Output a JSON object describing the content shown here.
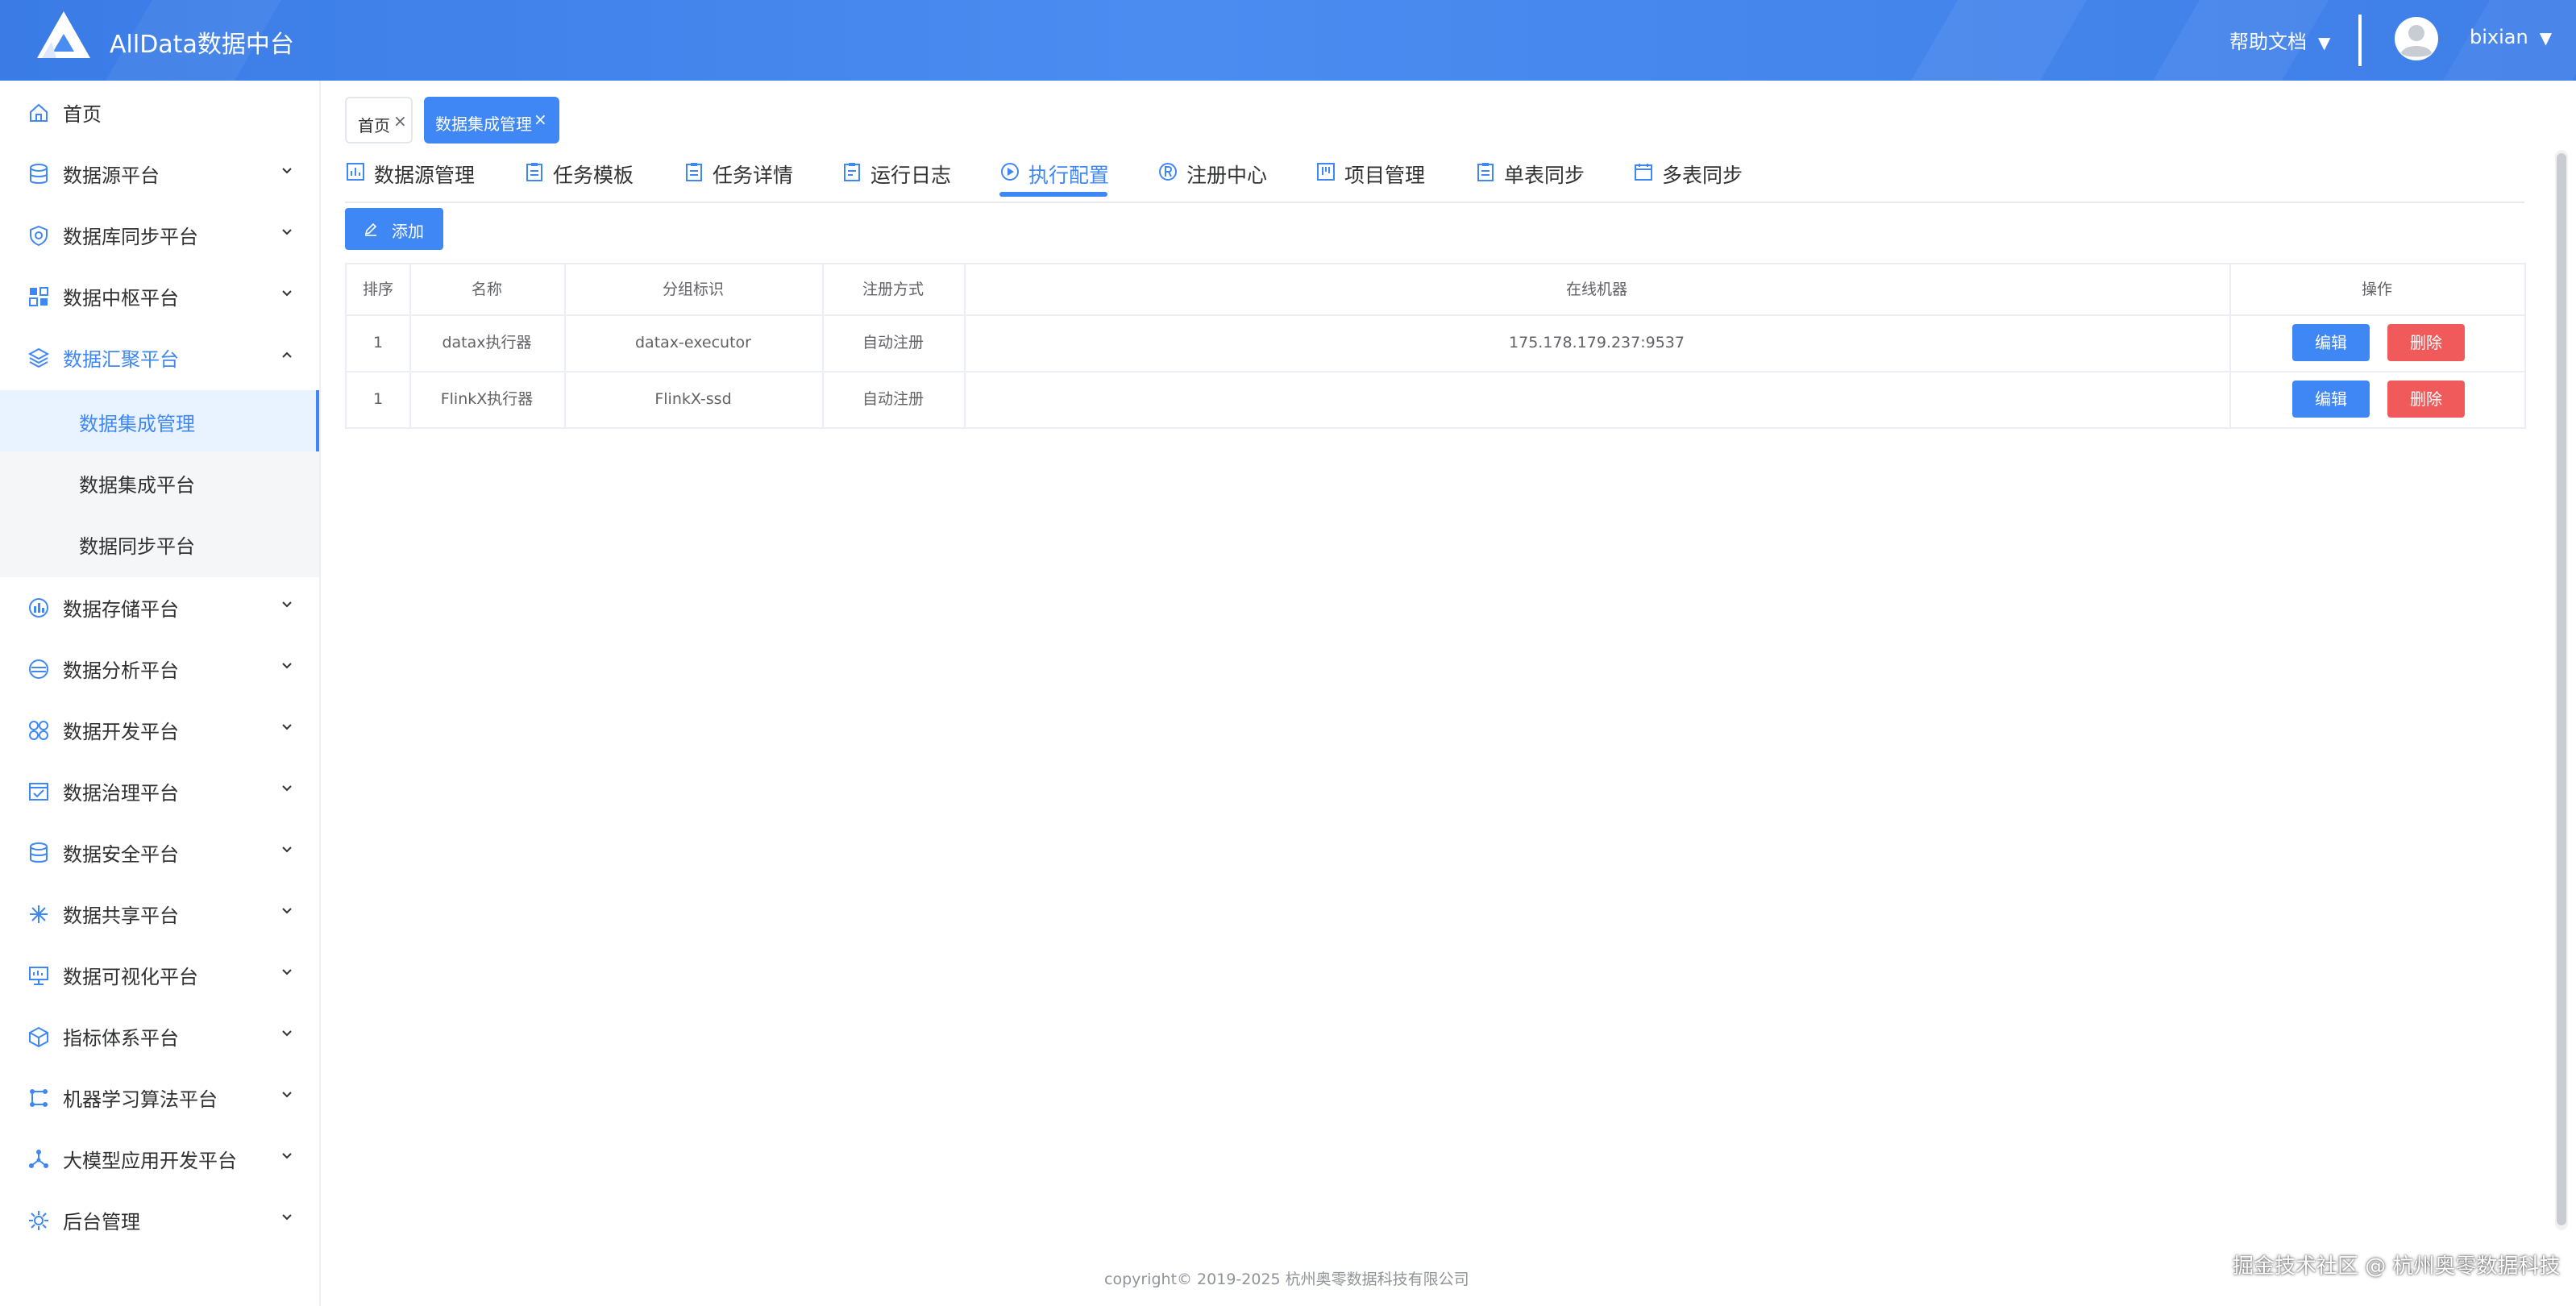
{
  "header": {
    "title": "AllData数据中台",
    "help_label": "帮助文档",
    "user_name": "bixian",
    "caret": "▼"
  },
  "sidebar": {
    "items": [
      {
        "label": "首页",
        "icon": "home-icon"
      },
      {
        "label": "数据源平台",
        "icon": "database-icon"
      },
      {
        "label": "数据库同步平台",
        "icon": "sync-shield-icon"
      },
      {
        "label": "数据中枢平台",
        "icon": "hub-grid-icon"
      },
      {
        "label": "数据汇聚平台",
        "icon": "layers-icon"
      },
      {
        "label": "数据存储平台",
        "icon": "storage-chart-icon"
      },
      {
        "label": "数据分析平台",
        "icon": "analysis-icon"
      },
      {
        "label": "数据开发平台",
        "icon": "dev-circles-icon"
      },
      {
        "label": "数据治理平台",
        "icon": "governance-icon"
      },
      {
        "label": "数据安全平台",
        "icon": "security-database-icon"
      },
      {
        "label": "数据共享平台",
        "icon": "share-network-icon"
      },
      {
        "label": "数据可视化平台",
        "icon": "monitor-icon"
      },
      {
        "label": "指标体系平台",
        "icon": "cube-icon"
      },
      {
        "label": "机器学习算法平台",
        "icon": "ml-nodes-icon"
      },
      {
        "label": "大模型应用开发平台",
        "icon": "llm-graph-icon"
      },
      {
        "label": "后台管理",
        "icon": "admin-gear-icon"
      }
    ],
    "subitems": [
      {
        "label": "数据集成管理",
        "selected": true
      },
      {
        "label": "数据集成平台",
        "selected": false
      },
      {
        "label": "数据同步平台",
        "selected": false
      }
    ]
  },
  "tags": [
    {
      "label": "首页",
      "active": false
    },
    {
      "label": "数据集成管理",
      "active": true
    }
  ],
  "tag_close": "×",
  "tabs": [
    {
      "label": "数据源管理",
      "icon": "datasource-icon"
    },
    {
      "label": "任务模板",
      "icon": "clipboard-icon"
    },
    {
      "label": "任务详情",
      "icon": "clipboard-icon"
    },
    {
      "label": "运行日志",
      "icon": "log-icon"
    },
    {
      "label": "执行配置",
      "icon": "play-circle-icon",
      "active": true
    },
    {
      "label": "注册中心",
      "icon": "registered-icon"
    },
    {
      "label": "项目管理",
      "icon": "kanban-icon"
    },
    {
      "label": "单表同步",
      "icon": "clipboard-icon"
    },
    {
      "label": "多表同步",
      "icon": "calendar-icon"
    }
  ],
  "add_button": "添加",
  "table": {
    "headers": [
      "排序",
      "名称",
      "分组标识",
      "注册方式",
      "在线机器",
      "操作"
    ],
    "rows": [
      {
        "order": "1",
        "name": "datax执行器",
        "group": "datax-executor",
        "registration": "自动注册",
        "machines": "175.178.179.237:9537"
      },
      {
        "order": "1",
        "name": "FlinkX执行器",
        "group": "FlinkX-ssd",
        "registration": "自动注册",
        "machines": ""
      }
    ],
    "edit_label": "编辑",
    "delete_label": "删除"
  },
  "footer": "copyright© 2019-2025 杭州奥零数据科技有限公司",
  "watermark": "掘金技术社区 @ 杭州奥零数据科技",
  "colors": {
    "accent": "#3f87f5",
    "danger": "#f05a5a",
    "header": "#4a8cf0"
  }
}
